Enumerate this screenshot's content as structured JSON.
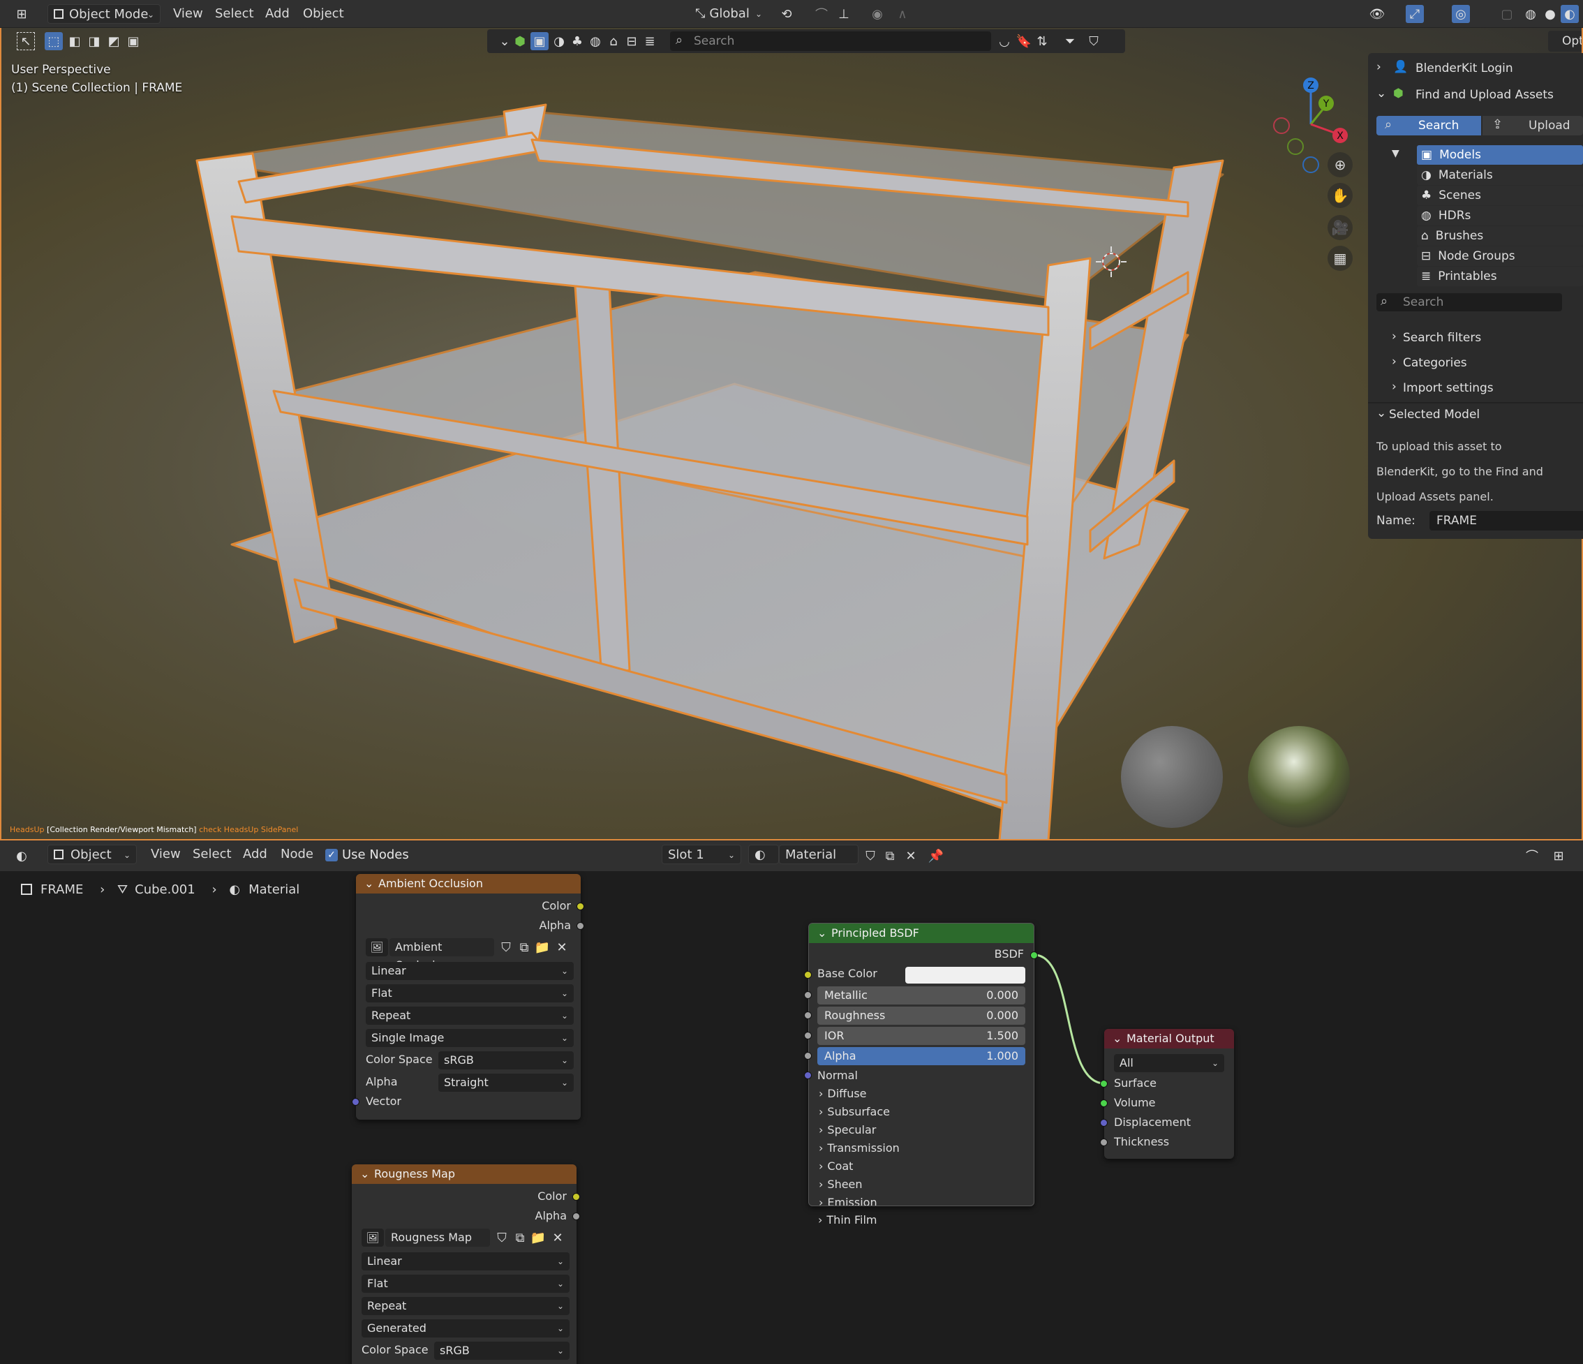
{
  "header": {
    "mode": "Object Mode",
    "menus": [
      "View",
      "Select",
      "Add",
      "Object"
    ],
    "transform": "Global",
    "search_placeholder": "Search",
    "right_label": "Opti"
  },
  "viewport": {
    "perspective": "User Perspective",
    "collection": "(1) Scene Collection | FRAME",
    "axes": [
      "Z",
      "Y",
      "X"
    ],
    "status_prefix": "HeadsUp",
    "status_msg": "[Collection Render/Viewport Mismatch]",
    "status_suffix": "check HeadsUp SidePanel"
  },
  "npanel": {
    "login": "BlenderKit Login",
    "find_upload": "Find and Upload Assets",
    "tab_search": "Search",
    "tab_upload": "Upload",
    "categories": [
      "Models",
      "Materials",
      "Scenes",
      "HDRs",
      "Brushes",
      "Node Groups",
      "Printables"
    ],
    "search_placeholder": "Search",
    "search_filters": "Search filters",
    "categories_label": "Categories",
    "import_settings": "Import settings",
    "selected_model": "Selected Model",
    "upload_note": [
      "To upload this asset to",
      "BlenderKit, go to the Find and",
      "Upload Assets panel."
    ],
    "name_label": "Name:",
    "name_value": "FRAME"
  },
  "node_editor": {
    "object_dd": "Object",
    "menus": [
      "View",
      "Select",
      "Add",
      "Node"
    ],
    "use_nodes": "Use Nodes",
    "slot": "Slot 1",
    "material": "Material",
    "breadcrumb": [
      "FRAME",
      "Cube.001",
      "Material"
    ]
  },
  "ao_node": {
    "title": "Ambient Occlusion",
    "out_color": "Color",
    "out_alpha": "Alpha",
    "image": "Ambient Occlusion",
    "interp": "Linear",
    "proj": "Flat",
    "ext": "Repeat",
    "source": "Single Image",
    "cs_label": "Color Space",
    "cs_value": "sRGB",
    "alpha_label": "Alpha",
    "alpha_value": "Straight",
    "vector": "Vector"
  },
  "rough_node": {
    "title": "Rougness Map",
    "out_color": "Color",
    "out_alpha": "Alpha",
    "image": "Rougness Map",
    "interp": "Linear",
    "proj": "Flat",
    "ext": "Repeat",
    "source": "Generated",
    "cs_label": "Color Space",
    "cs_value": "sRGB"
  },
  "bsdf_node": {
    "title": "Principled BSDF",
    "out": "BSDF",
    "base_color": "Base Color",
    "metallic_label": "Metallic",
    "metallic": "0.000",
    "roughness_label": "Roughness",
    "roughness": "0.000",
    "ior_label": "IOR",
    "ior": "1.500",
    "alpha_label": "Alpha",
    "alpha": "1.000",
    "normal": "Normal",
    "panels": [
      "Diffuse",
      "Subsurface",
      "Specular",
      "Transmission",
      "Coat",
      "Sheen",
      "Emission",
      "Thin Film"
    ]
  },
  "output_node": {
    "title": "Material Output",
    "target": "All",
    "inputs": [
      "Surface",
      "Volume",
      "Displacement",
      "Thickness"
    ]
  },
  "colors": {
    "accent_blue": "#4772b3",
    "select_orange": "#e08a3c",
    "image_node_header": "#7a4a21",
    "bsdf_header": "#2c6a2c",
    "output_header": "#5b1f2a"
  }
}
